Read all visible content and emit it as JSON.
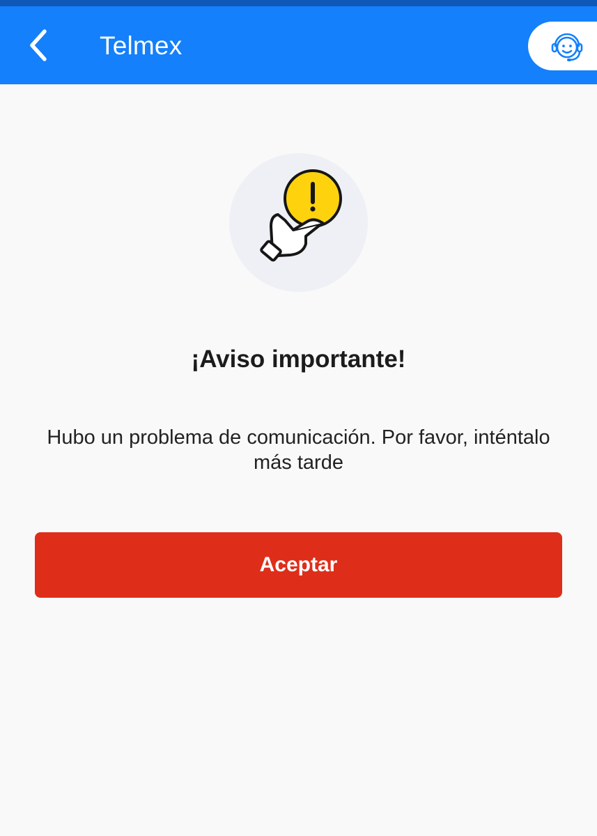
{
  "header": {
    "title": "Telmex",
    "back_icon": "chevron-left-icon",
    "support_icon": "support-agent-icon",
    "background_color": "#1480fb"
  },
  "dialog": {
    "illustration_icon": "hand-pressing-warning-icon",
    "title": "¡Aviso importante!",
    "message": "Hubo un problema de comunicación. Por favor, inténtalo más tarde",
    "accept_label": "Aceptar",
    "accept_color": "#de2e1a",
    "warning_color": "#ffd20e"
  }
}
